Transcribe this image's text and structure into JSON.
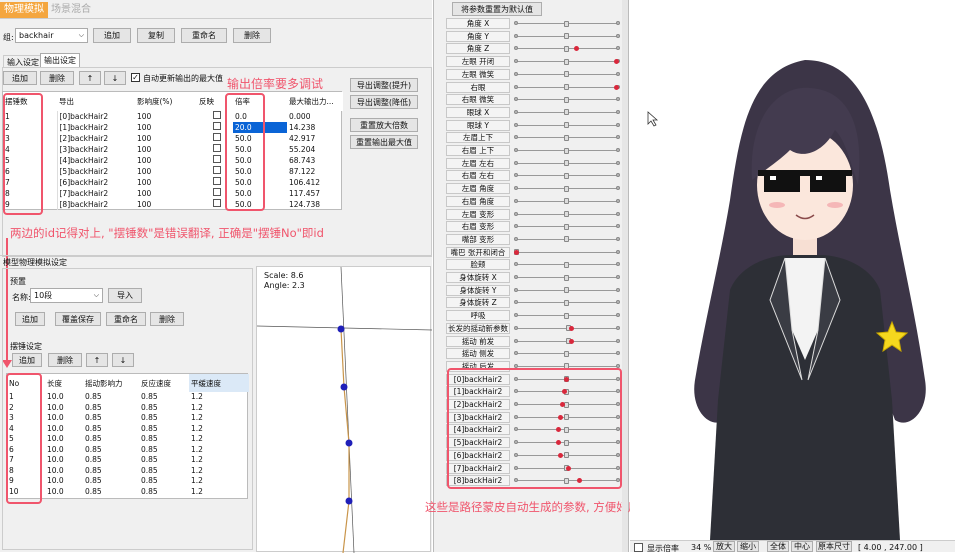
{
  "tabs": {
    "physics": "物理模拟",
    "scene_blend": "场景混合"
  },
  "group": {
    "label": "组:",
    "value": "backhair",
    "add": "追加",
    "copy": "复制",
    "rename": "重命名",
    "delete": "删除"
  },
  "subtabs": {
    "input": "输入设定",
    "output": "输出设定"
  },
  "out_toolbar": {
    "add": "追加",
    "delete": "删除",
    "up": "↑",
    "down": "↓",
    "auto_update": "自动更新输出的最大值"
  },
  "out_table": {
    "headers": [
      "摆锤数",
      "导出",
      "影响度(%)",
      "反映",
      "倍率",
      "最大输出力..."
    ],
    "rows": [
      [
        "1",
        "[0]backHair2",
        "100",
        "",
        "0.0",
        "0.000"
      ],
      [
        "2",
        "[1]backHair2",
        "100",
        "",
        "20.0",
        "14.238"
      ],
      [
        "3",
        "[2]backHair2",
        "100",
        "",
        "50.0",
        "42.917"
      ],
      [
        "4",
        "[3]backHair2",
        "100",
        "",
        "50.0",
        "55.204"
      ],
      [
        "5",
        "[4]backHair2",
        "100",
        "",
        "50.0",
        "68.743"
      ],
      [
        "6",
        "[5]backHair2",
        "100",
        "",
        "50.0",
        "87.122"
      ],
      [
        "7",
        "[6]backHair2",
        "100",
        "",
        "50.0",
        "106.412"
      ],
      [
        "8",
        "[7]backHair2",
        "100",
        "",
        "50.0",
        "117.457"
      ],
      [
        "9",
        "[8]backHair2",
        "100",
        "",
        "50.0",
        "124.738"
      ]
    ]
  },
  "side_buttons": {
    "export_up": "导出调整(提升)",
    "export_down": "导出调整(降低)",
    "reset_zoom": "重置放大倍数",
    "reset_max": "重置输出最大值"
  },
  "notes": {
    "multiplier": "输出倍率要多调试",
    "id_note": "两边的id记得对上, \"摆锤数\"是错误翻译, 正确是\"摆锤No\"即id",
    "auto_params": "这些是路径蒙皮自动生成的参数, 方便好用"
  },
  "model_sim": {
    "title": "模型物理模拟设定",
    "preset": "预置",
    "name_label": "名称:",
    "name_value": "10段",
    "import": "导入",
    "add": "追加",
    "overwrite": "覆盖保存",
    "rename": "重命名",
    "delete": "删除",
    "pendulum": "摆锤设定",
    "p_add": "追加",
    "p_delete": "删除",
    "p_up": "↑",
    "p_down": "↓",
    "headers": [
      "No",
      "长度",
      "摇动影响力",
      "反应速度",
      "平缓速度"
    ],
    "rows": [
      [
        "1",
        "10.0",
        "0.85",
        "0.85",
        "1.2"
      ],
      [
        "2",
        "10.0",
        "0.85",
        "0.85",
        "1.2"
      ],
      [
        "3",
        "10.0",
        "0.85",
        "0.85",
        "1.2"
      ],
      [
        "4",
        "10.0",
        "0.85",
        "0.85",
        "1.2"
      ],
      [
        "5",
        "10.0",
        "0.85",
        "0.85",
        "1.2"
      ],
      [
        "6",
        "10.0",
        "0.85",
        "0.85",
        "1.2"
      ],
      [
        "7",
        "10.0",
        "0.85",
        "0.85",
        "1.2"
      ],
      [
        "8",
        "10.0",
        "0.85",
        "0.85",
        "1.2"
      ],
      [
        "9",
        "10.0",
        "0.85",
        "0.85",
        "1.2"
      ],
      [
        "10",
        "10.0",
        "0.85",
        "0.85",
        "1.2"
      ]
    ]
  },
  "preview": {
    "scale": "Scale: 8.6",
    "angle": "Angle: 2.3"
  },
  "params": {
    "reset_all": "将参数重置为默认值",
    "items": [
      {
        "label": "角度 X",
        "knob": 0.5
      },
      {
        "label": "角度 Y",
        "knob": 0.5
      },
      {
        "label": "角度 Z",
        "knob": 0.5,
        "red": 0.6
      },
      {
        "label": "左眼 开闭",
        "knob": 0.5,
        "red": 1.0
      },
      {
        "label": "左眼 微笑",
        "knob": 0.5
      },
      {
        "label": "右眼",
        "knob": 0.5,
        "red": 1.0
      },
      {
        "label": "右眼 微笑",
        "knob": 0.5
      },
      {
        "label": "眼球 X",
        "knob": 0.5
      },
      {
        "label": "眼球 Y",
        "knob": 0.5
      },
      {
        "label": "左眉上下",
        "knob": 0.5
      },
      {
        "label": "右眉 上下",
        "knob": 0.5
      },
      {
        "label": "左眉 左右",
        "knob": 0.5
      },
      {
        "label": "右眉 左右",
        "knob": 0.5
      },
      {
        "label": "左眉 角度",
        "knob": 0.5
      },
      {
        "label": "右眉 角度",
        "knob": 0.5
      },
      {
        "label": "左眉 变形",
        "knob": 0.5
      },
      {
        "label": "右眉 变形",
        "knob": 0.5
      },
      {
        "label": "嘴部 变形",
        "knob": 0.5
      },
      {
        "label": "嘴巴 张开和闭合",
        "knob": 0.0,
        "red": 0.0
      },
      {
        "label": "脸颊",
        "knob": 0.5
      },
      {
        "label": "身体旋转 X",
        "knob": 0.5
      },
      {
        "label": "身体旋转 Y",
        "knob": 0.5
      },
      {
        "label": "身体旋转 Z",
        "knob": 0.5
      },
      {
        "label": "呼吸",
        "knob": 0.5
      },
      {
        "label": "长发的摇动新参数",
        "knob": 0.52,
        "red": 0.55
      },
      {
        "label": "摇动 前发",
        "knob": 0.52,
        "red": 0.55
      },
      {
        "label": "摇动 侧发",
        "knob": 0.5
      },
      {
        "label": "摇动 后发",
        "knob": 0.5
      },
      {
        "label": "[0]backHair2",
        "knob": 0.5,
        "red": 0.5
      },
      {
        "label": "[1]backHair2",
        "knob": 0.5,
        "red": 0.48
      },
      {
        "label": "[2]backHair2",
        "knob": 0.5,
        "red": 0.46
      },
      {
        "label": "[3]backHair2",
        "knob": 0.5,
        "red": 0.44
      },
      {
        "label": "[4]backHair2",
        "knob": 0.5,
        "red": 0.42
      },
      {
        "label": "[5]backHair2",
        "knob": 0.5,
        "red": 0.42
      },
      {
        "label": "[6]backHair2",
        "knob": 0.5,
        "red": 0.44
      },
      {
        "label": "[7]backHair2",
        "knob": 0.5,
        "red": 0.52
      },
      {
        "label": "[8]backHair2",
        "knob": 0.5,
        "red": 0.63
      }
    ]
  },
  "statusbar": {
    "show_ratio": "显示倍率",
    "zoom": "34 %",
    "zoom_in": "放大",
    "zoom_out": "缩小",
    "full": "全体",
    "center": "中心",
    "original": "原本尺寸",
    "coords": "[ 4.00 , 247.00 ]"
  }
}
